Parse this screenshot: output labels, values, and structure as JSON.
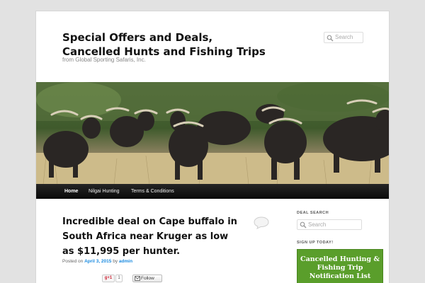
{
  "site": {
    "title": "Special Offers and Deals, Cancelled Hunts and Fishing Trips",
    "description": "from Global Sporting Safaris, Inc."
  },
  "header_search": {
    "placeholder": "Search"
  },
  "nav": {
    "items": [
      {
        "label": "Home",
        "active": true
      },
      {
        "label": "Nilgai Hunting",
        "active": false
      },
      {
        "label": "Terms & Conditions",
        "active": false
      }
    ]
  },
  "post": {
    "title": "Incredible deal on Cape buffalo in South Africa near Kruger as low as $11,995 per hunter.",
    "posted_on_label": "Posted on",
    "date": "April 3, 2015",
    "by_label": "by",
    "author": "admin"
  },
  "share": {
    "gplus_label": "g+1",
    "gplus_count": "1",
    "follow_label": "Follow"
  },
  "sidebar": {
    "deal_search": {
      "title": "DEAL SEARCH",
      "placeholder": "Search"
    },
    "signup": {
      "title": "SIGN UP TODAY!",
      "box_text": "Cancelled Hunting & Fishing Trip Notification List"
    }
  },
  "colors": {
    "nav_bg": "#111111",
    "link": "#1b8be0",
    "signup_bg": "#5a9e2b"
  },
  "icons": [
    "search-icon",
    "comment-bubble-icon",
    "follow-icon"
  ]
}
